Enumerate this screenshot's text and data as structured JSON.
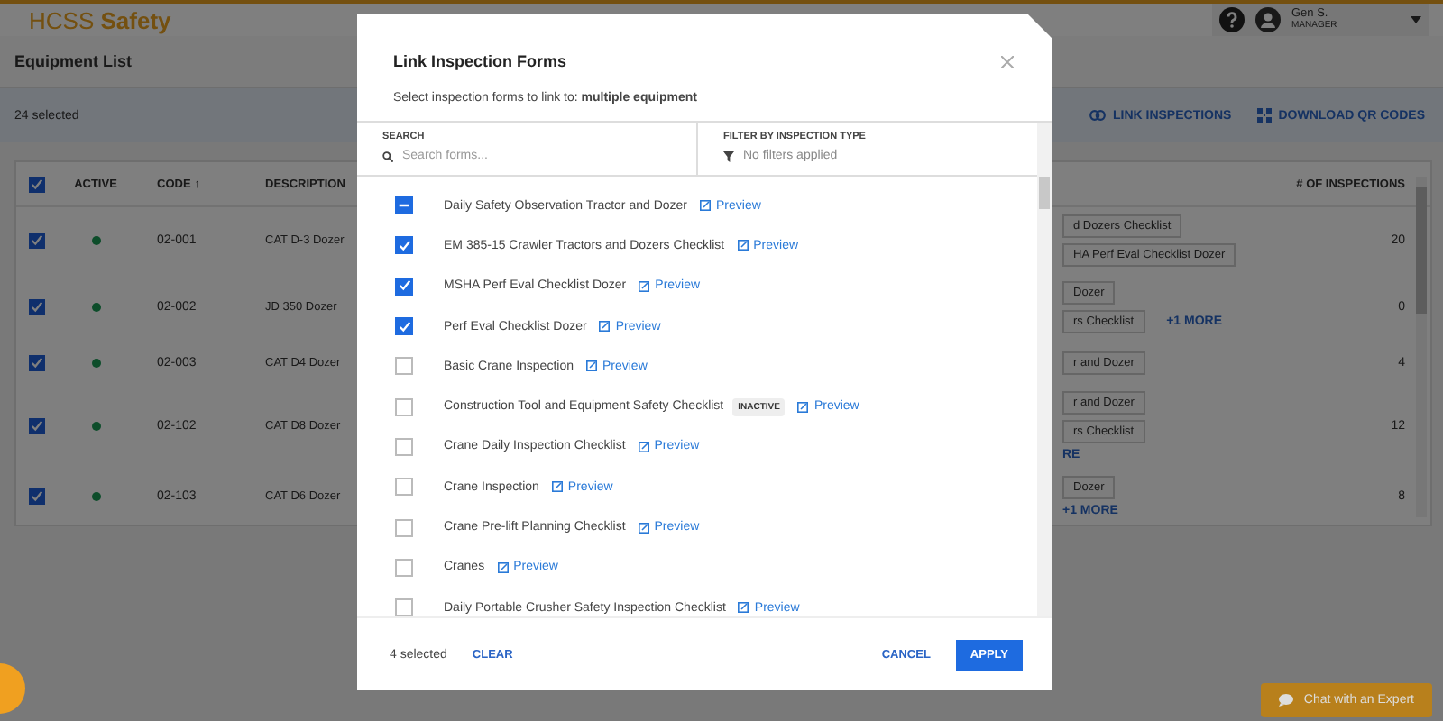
{
  "app": {
    "logo_light": "HCSS",
    "logo_bold": "Safety",
    "user_name": "Gen S.",
    "user_role": "MANAGER"
  },
  "page": {
    "title": "Equipment List",
    "selected_count": "24 selected",
    "actions": [
      "LINK INSPECTIONS",
      "DOWNLOAD QR CODES"
    ]
  },
  "table": {
    "all_checked": true,
    "columns": [
      "ACTIVE",
      "CODE ↑",
      "DESCRIPTION",
      "# OF INSPECTIONS"
    ],
    "rows": [
      {
        "checked": true,
        "active": true,
        "code": "02-001",
        "description": "CAT D-3 Dozer",
        "tag_lines": [
          [
            {
              "kind": "tag",
              "text": "d Dozers Checklist"
            }
          ],
          [
            {
              "kind": "tag",
              "text": "HA Perf Eval Checklist Dozer"
            }
          ]
        ],
        "inspections": "20"
      },
      {
        "checked": true,
        "active": true,
        "code": "02-002",
        "description": "JD 350 Dozer",
        "tag_lines": [
          [
            {
              "kind": "tag",
              "text": "Dozer"
            }
          ],
          [
            {
              "kind": "tag",
              "text": "rs Checklist"
            },
            {
              "kind": "more",
              "text": "+1 MORE"
            }
          ]
        ],
        "inspections": "0"
      },
      {
        "checked": true,
        "active": true,
        "code": "02-003",
        "description": "CAT D4 Dozer",
        "tag_lines": [
          [
            {
              "kind": "tag",
              "text": "r and Dozer"
            }
          ]
        ],
        "inspections": "4"
      },
      {
        "checked": true,
        "active": true,
        "code": "02-102",
        "description": "CAT D8 Dozer",
        "tag_lines": [
          [
            {
              "kind": "tag",
              "text": "r and Dozer"
            }
          ],
          [
            {
              "kind": "tag",
              "text": "rs Checklist"
            }
          ],
          [
            {
              "kind": "more",
              "text": "RE"
            }
          ]
        ],
        "inspections": "12"
      },
      {
        "checked": true,
        "active": true,
        "code": "02-103",
        "description": "CAT D6 Dozer",
        "tag_lines": [
          [
            {
              "kind": "tag",
              "text": "Dozer"
            }
          ],
          [
            {
              "kind": "more",
              "text": "+1 MORE"
            }
          ]
        ],
        "inspections": "8"
      }
    ]
  },
  "chat_button": "Chat with an Expert",
  "modal": {
    "title": "Link Inspection Forms",
    "subtitle": "Select inspection forms to link to: **multiple equipment**",
    "search_label": "SEARCH",
    "search_placeholder": "Search forms...",
    "filter_label": "FILTER BY INSPECTION TYPE",
    "filter_value": "No filters applied",
    "forms": [
      {
        "name": "Daily Safety Observation Tractor and Dozer",
        "checked": false,
        "indeterminate": true,
        "preview": "Preview"
      },
      {
        "name": "EM 385-15 Crawler Tractors and Dozers Checklist",
        "checked": true,
        "preview": "Preview"
      },
      {
        "name": "MSHA Perf Eval Checklist Dozer",
        "checked": true,
        "preview": "Preview"
      },
      {
        "name": "Perf Eval Checklist Dozer",
        "checked": true,
        "preview": "Preview"
      },
      {
        "name": "Basic Crane Inspection",
        "checked": false,
        "preview": "Preview"
      },
      {
        "name": "Construction Tool and Equipment Safety Checklist",
        "checked": false,
        "badge": "INACTIVE",
        "preview": "Preview"
      },
      {
        "name": "Crane Daily Inspection Checklist",
        "checked": false,
        "preview": "Preview"
      },
      {
        "name": "Crane Inspection",
        "checked": false,
        "preview": "Preview"
      },
      {
        "name": "Crane Pre-lift Planning Checklist",
        "checked": false,
        "preview": "Preview"
      },
      {
        "name": "Cranes",
        "checked": false,
        "preview": "Preview"
      },
      {
        "name": "Daily Portable Crusher Safety Inspection Checklist",
        "checked": false,
        "preview": "Preview"
      }
    ],
    "selected_count": "4 selected",
    "clear": "CLEAR",
    "cancel": "CANCEL",
    "apply": "APPLY"
  }
}
